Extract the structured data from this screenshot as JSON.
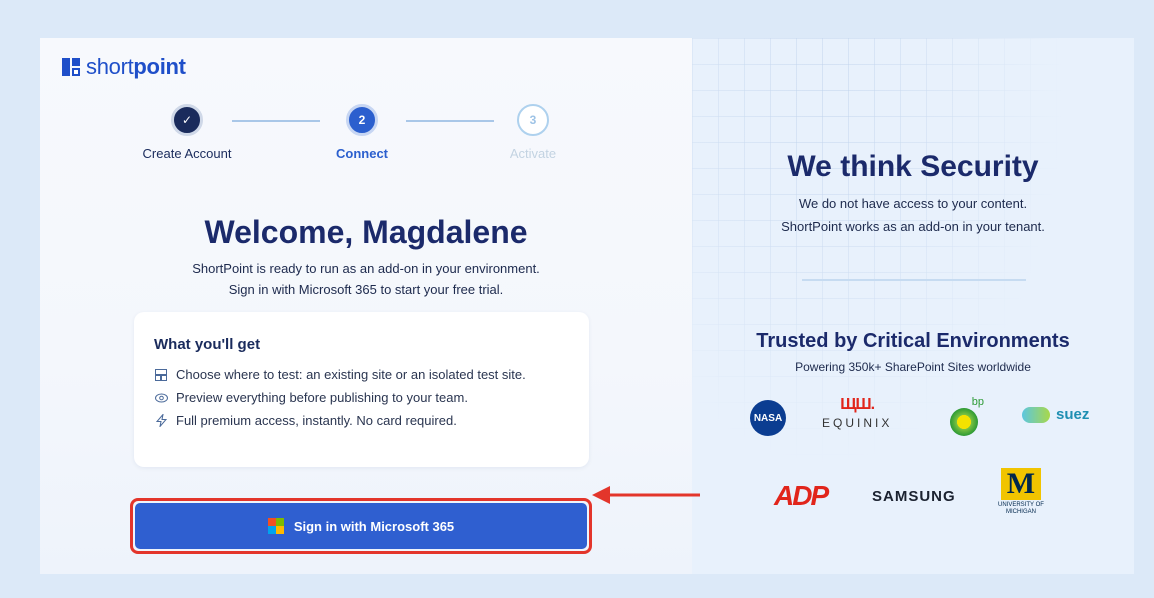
{
  "brand": {
    "light": "short",
    "bold": "point"
  },
  "stepper": {
    "steps": [
      {
        "label": "Create Account",
        "state": "done",
        "number": "✓"
      },
      {
        "label": "Connect",
        "state": "active",
        "number": "2"
      },
      {
        "label": "Activate",
        "state": "pending",
        "number": "3"
      }
    ]
  },
  "main": {
    "title": "Welcome, Magdalene",
    "subtitle_line1": "ShortPoint is ready to run as an add-on in your environment.",
    "subtitle_line2": "Sign in with Microsoft 365 to start your free trial."
  },
  "card": {
    "title": "What you'll get",
    "items": [
      {
        "icon": "layout-icon",
        "text": "Choose where to test: an existing site or an isolated test site."
      },
      {
        "icon": "eye-icon",
        "text": "Preview everything before publishing to your team."
      },
      {
        "icon": "lightning-icon",
        "text": "Full premium access, instantly. No card required."
      }
    ]
  },
  "signin": {
    "label": "Sign in with Microsoft 365",
    "icon": "microsoft-icon"
  },
  "security": {
    "title": "We think Security",
    "line1": "We do not have access to your content.",
    "line2": "ShortPoint works as an add-on in your tenant."
  },
  "trust": {
    "title": "Trusted by Critical Environments",
    "subtitle": "Powering 350k+ SharePoint Sites worldwide",
    "logos": {
      "nasa": "NASA",
      "equinix": "EQUINIX",
      "bp": "bp",
      "suez": "suez",
      "adp": "ADP",
      "samsung": "SAMSUNG",
      "umich_1": "UNIVERSITY OF",
      "umich_2": "MICHIGAN"
    }
  },
  "colors": {
    "accent": "#2f5fd0",
    "highlight": "#e3352b",
    "heading": "#1b2a6b"
  }
}
